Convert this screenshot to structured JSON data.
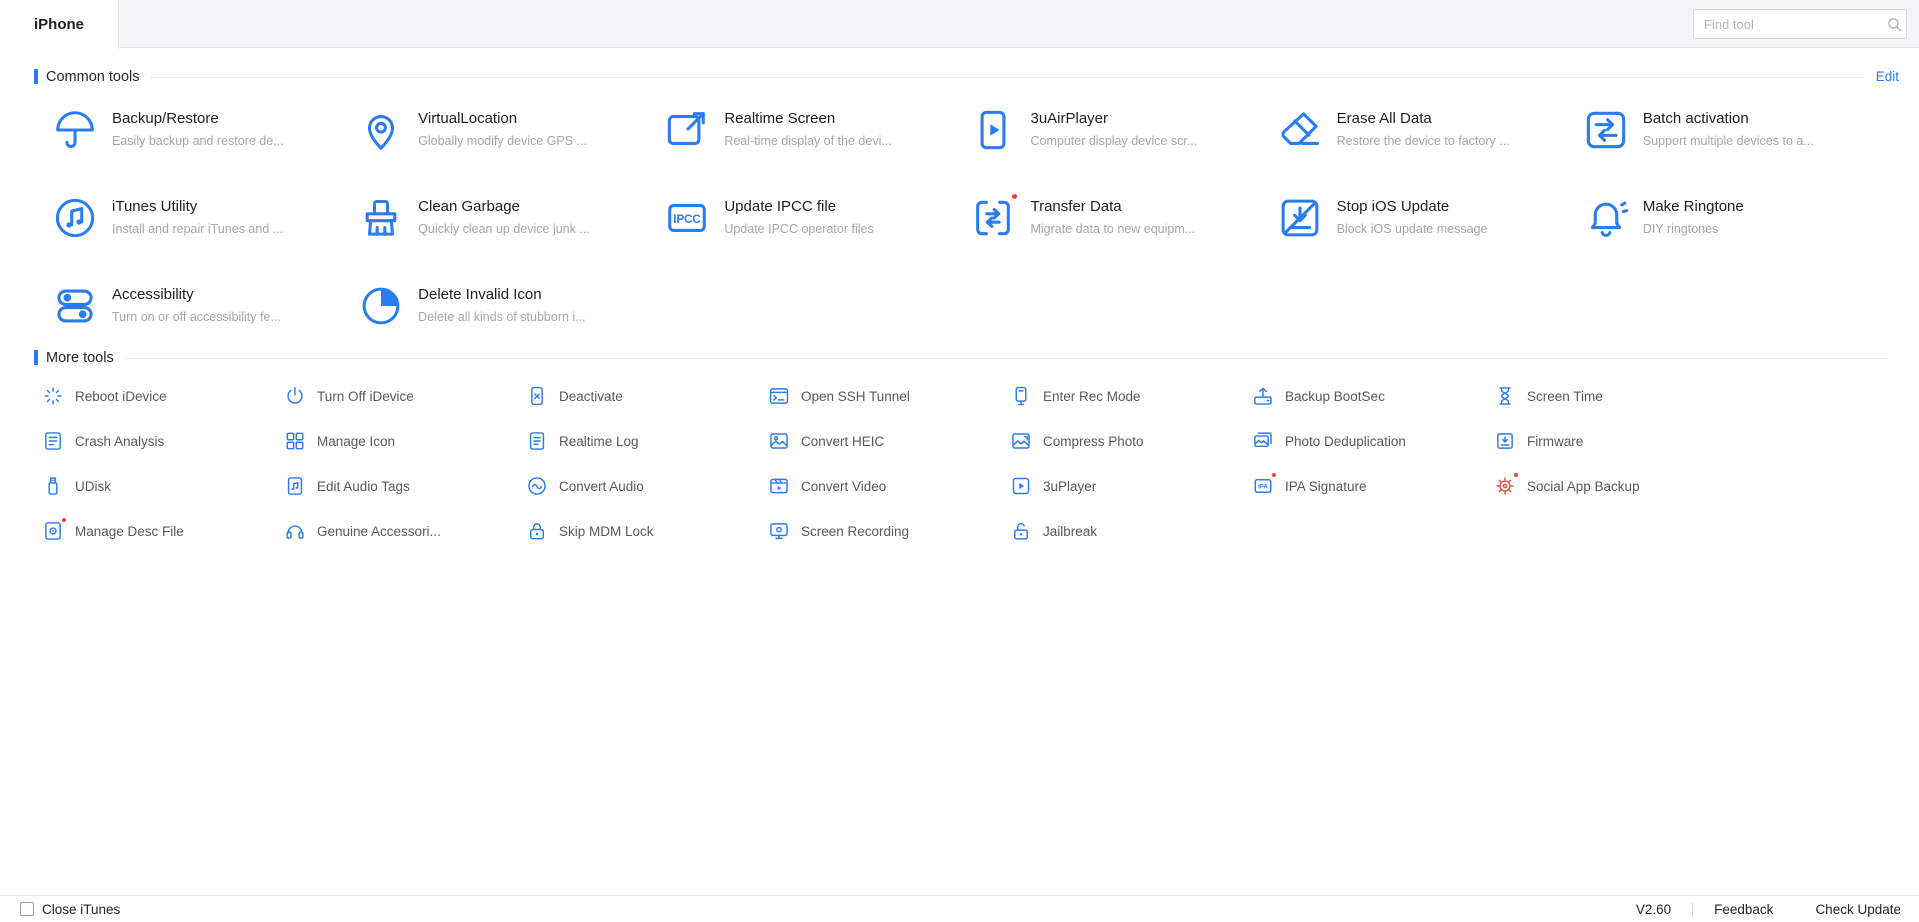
{
  "window": {
    "tab": "iPhone",
    "search_placeholder": "Find tool"
  },
  "icons": {
    "ipcc_label": "IPCC",
    "ipa_label": "IPA"
  },
  "colors": {
    "accent": "#2b7cf0",
    "badge": "#f53f3f",
    "social_gear": "#e2543c"
  },
  "common_tools": {
    "title": "Common tools",
    "edit_label": "Edit",
    "items": [
      {
        "icon": "umbrella-icon",
        "title": "Backup/Restore",
        "desc": "Easily backup and restore de..."
      },
      {
        "icon": "location-pin-icon",
        "title": "VirtualLocation",
        "desc": "Globally modify device GPS ..."
      },
      {
        "icon": "realtime-screen-icon",
        "title": "Realtime Screen",
        "desc": "Real-time display of the devi..."
      },
      {
        "icon": "airplayer-icon",
        "title": "3uAirPlayer",
        "desc": "Computer display device scr..."
      },
      {
        "icon": "eraser-icon",
        "title": "Erase All Data",
        "desc": "Restore the device to factory ..."
      },
      {
        "icon": "batch-activation-icon",
        "title": "Batch activation",
        "desc": "Support multiple devices to a..."
      },
      {
        "icon": "itunes-icon",
        "title": "iTunes Utility",
        "desc": "Install and repair iTunes and ..."
      },
      {
        "icon": "clean-brush-icon",
        "title": "Clean Garbage",
        "desc": "Quickly clean up device junk ..."
      },
      {
        "icon": "ipcc-file-icon",
        "title": "Update IPCC file",
        "desc": "Update IPCC operator files"
      },
      {
        "icon": "transfer-data-icon",
        "title": "Transfer Data",
        "desc": "Migrate data to new equipm...",
        "badge": true
      },
      {
        "icon": "stop-update-icon",
        "title": "Stop iOS Update",
        "desc": "Block iOS update message"
      },
      {
        "icon": "ringtone-bell-icon",
        "title": "Make Ringtone",
        "desc": "DIY ringtones"
      },
      {
        "icon": "accessibility-icon",
        "title": "Accessibility",
        "desc": "Turn on or off accessibility fe..."
      },
      {
        "icon": "delete-invalid-icon",
        "title": "Delete Invalid Icon",
        "desc": "Delete all kinds of stubborn i..."
      }
    ]
  },
  "more_tools": {
    "title": "More tools",
    "items": [
      {
        "icon": "reboot-icon",
        "label": "Reboot iDevice"
      },
      {
        "icon": "power-off-icon",
        "label": "Turn Off iDevice"
      },
      {
        "icon": "deactivate-icon",
        "label": "Deactivate"
      },
      {
        "icon": "ssh-tunnel-icon",
        "label": "Open SSH Tunnel"
      },
      {
        "icon": "rec-mode-icon",
        "label": "Enter Rec Mode"
      },
      {
        "icon": "backup-bootsec-icon",
        "label": "Backup BootSec"
      },
      {
        "icon": "screen-time-icon",
        "label": "Screen Time"
      },
      {
        "icon": "crash-analysis-icon",
        "label": "Crash Analysis"
      },
      {
        "icon": "manage-icon-icon",
        "label": "Manage Icon"
      },
      {
        "icon": "realtime-log-icon",
        "label": "Realtime Log"
      },
      {
        "icon": "convert-heic-icon",
        "label": "Convert HEIC"
      },
      {
        "icon": "compress-photo-icon",
        "label": "Compress Photo"
      },
      {
        "icon": "photo-dedup-icon",
        "label": "Photo Deduplication"
      },
      {
        "icon": "firmware-icon",
        "label": "Firmware"
      },
      {
        "icon": "udisk-icon",
        "label": "UDisk"
      },
      {
        "icon": "edit-audio-tags-icon",
        "label": "Edit Audio Tags"
      },
      {
        "icon": "convert-audio-icon",
        "label": "Convert Audio"
      },
      {
        "icon": "convert-video-icon",
        "label": "Convert Video"
      },
      {
        "icon": "3uplayer-icon",
        "label": "3uPlayer"
      },
      {
        "icon": "ipa-signature-icon",
        "label": "IPA Signature",
        "badge": true
      },
      {
        "icon": "social-backup-icon",
        "label": "Social App Backup",
        "badge": true,
        "icon_color": "#e2543c"
      },
      {
        "icon": "manage-desc-icon",
        "label": "Manage Desc File",
        "badge": true
      },
      {
        "icon": "genuine-accessory-icon",
        "label": "Genuine Accessori..."
      },
      {
        "icon": "skip-mdm-icon",
        "label": "Skip MDM Lock"
      },
      {
        "icon": "screen-recording-icon",
        "label": "Screen Recording"
      },
      {
        "icon": "jailbreak-icon",
        "label": "Jailbreak"
      }
    ]
  },
  "footer": {
    "close_itunes_label": "Close iTunes",
    "version": "V2.60",
    "feedback_label": "Feedback",
    "check_update_label": "Check Update"
  }
}
